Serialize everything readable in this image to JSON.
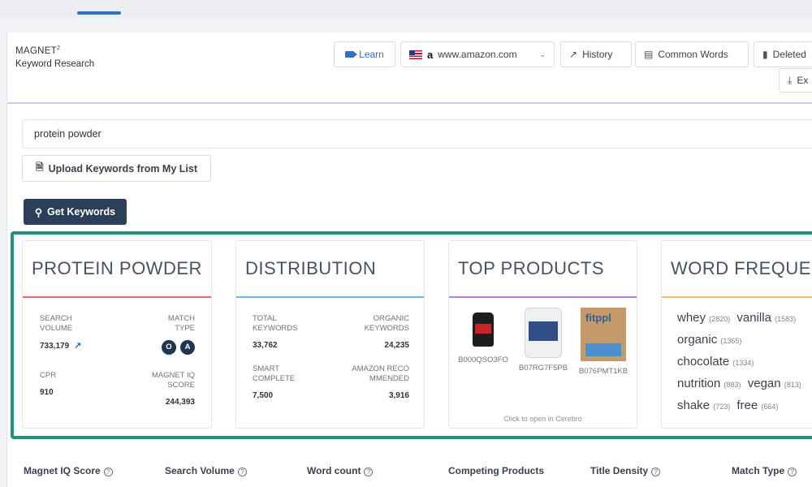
{
  "brand": {
    "title": "MAGNET",
    "superscript": "2",
    "subtitle": "Keyword Research"
  },
  "toolbar": {
    "learn_label": "Learn",
    "marketplace_label": "www.amazon.com",
    "history_label": "History",
    "common_words_label": "Common Words",
    "deleted_label": "Deleted",
    "export_label": "Ex"
  },
  "search": {
    "value": "protein powder"
  },
  "upload_label": "Upload Keywords from My List",
  "get_keywords_label": "Get Keywords",
  "cards": {
    "keyword": {
      "title": "PROTEIN POWDER",
      "search_volume_label": "SEARCH VOLUME",
      "search_volume": "733,179",
      "match_type_label": "MATCH TYPE",
      "match_badges": [
        "O",
        "A"
      ],
      "cpr_label": "CPR",
      "cpr": "910",
      "iq_label": "MAGNET IQ SCORE",
      "iq": "244,393"
    },
    "distribution": {
      "title": "DISTRIBUTION",
      "total_label": "TOTAL KEYWORDS",
      "total": "33,762",
      "organic_label": "ORGANIC KEYWORDS",
      "organic": "24,235",
      "smart_label": "SMART COMPLETE",
      "smart": "7,500",
      "amazon_label": "AMAZON RECOMMENDED",
      "amazon": "3,916"
    },
    "top_products": {
      "title": "TOP PRODUCTS",
      "products": [
        {
          "asin": "B000QSO3FO"
        },
        {
          "asin": "B07RG7F5PB"
        },
        {
          "asin": "B076PMT1KB"
        }
      ],
      "product3_logo": "fitppl",
      "footer": "Click to open in Cerebro"
    },
    "word_frequency": {
      "title": "WORD FREQUENCY",
      "words": [
        {
          "word": "whey",
          "count": "(2820)"
        },
        {
          "word": "vanilla",
          "count": "(1583)"
        },
        {
          "word": "organic",
          "count": "(1365)"
        },
        {
          "word": "chocolate",
          "count": "(1334)"
        },
        {
          "word": "nutrition",
          "count": "(883)"
        },
        {
          "word": "vegan",
          "count": "(813)"
        },
        {
          "word": "shake",
          "count": "(723)"
        },
        {
          "word": "free",
          "count": "(664)"
        }
      ]
    }
  },
  "filters": {
    "iq": "Magnet IQ Score",
    "volume": "Search Volume",
    "word_count": "Word count",
    "competing": "Competing Products",
    "title_density": "Title Density",
    "match_type": "Match Type"
  },
  "colors": {
    "accent": "#2f72c8",
    "highlight": "#1a9481",
    "primary_button": "#2b3f58"
  }
}
